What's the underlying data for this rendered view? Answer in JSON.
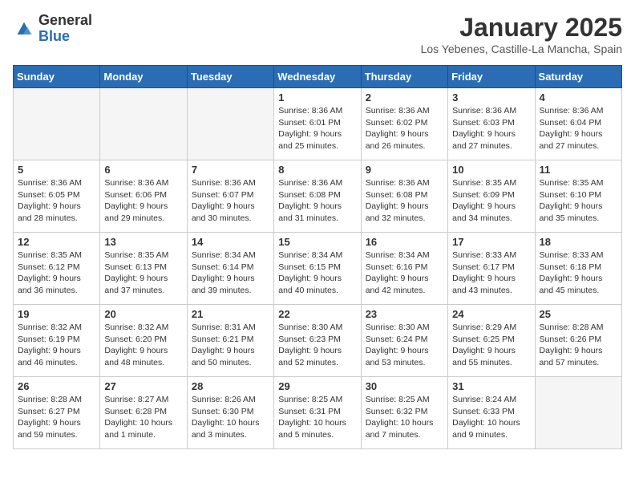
{
  "header": {
    "logo_general": "General",
    "logo_blue": "Blue",
    "month": "January 2025",
    "location": "Los Yebenes, Castille-La Mancha, Spain"
  },
  "days_of_week": [
    "Sunday",
    "Monday",
    "Tuesday",
    "Wednesday",
    "Thursday",
    "Friday",
    "Saturday"
  ],
  "weeks": [
    [
      {
        "day": "",
        "info": ""
      },
      {
        "day": "",
        "info": ""
      },
      {
        "day": "",
        "info": ""
      },
      {
        "day": "1",
        "info": "Sunrise: 8:36 AM\nSunset: 6:01 PM\nDaylight: 9 hours and 25 minutes."
      },
      {
        "day": "2",
        "info": "Sunrise: 8:36 AM\nSunset: 6:02 PM\nDaylight: 9 hours and 26 minutes."
      },
      {
        "day": "3",
        "info": "Sunrise: 8:36 AM\nSunset: 6:03 PM\nDaylight: 9 hours and 27 minutes."
      },
      {
        "day": "4",
        "info": "Sunrise: 8:36 AM\nSunset: 6:04 PM\nDaylight: 9 hours and 27 minutes."
      }
    ],
    [
      {
        "day": "5",
        "info": "Sunrise: 8:36 AM\nSunset: 6:05 PM\nDaylight: 9 hours and 28 minutes."
      },
      {
        "day": "6",
        "info": "Sunrise: 8:36 AM\nSunset: 6:06 PM\nDaylight: 9 hours and 29 minutes."
      },
      {
        "day": "7",
        "info": "Sunrise: 8:36 AM\nSunset: 6:07 PM\nDaylight: 9 hours and 30 minutes."
      },
      {
        "day": "8",
        "info": "Sunrise: 8:36 AM\nSunset: 6:08 PM\nDaylight: 9 hours and 31 minutes."
      },
      {
        "day": "9",
        "info": "Sunrise: 8:36 AM\nSunset: 6:08 PM\nDaylight: 9 hours and 32 minutes."
      },
      {
        "day": "10",
        "info": "Sunrise: 8:35 AM\nSunset: 6:09 PM\nDaylight: 9 hours and 34 minutes."
      },
      {
        "day": "11",
        "info": "Sunrise: 8:35 AM\nSunset: 6:10 PM\nDaylight: 9 hours and 35 minutes."
      }
    ],
    [
      {
        "day": "12",
        "info": "Sunrise: 8:35 AM\nSunset: 6:12 PM\nDaylight: 9 hours and 36 minutes."
      },
      {
        "day": "13",
        "info": "Sunrise: 8:35 AM\nSunset: 6:13 PM\nDaylight: 9 hours and 37 minutes."
      },
      {
        "day": "14",
        "info": "Sunrise: 8:34 AM\nSunset: 6:14 PM\nDaylight: 9 hours and 39 minutes."
      },
      {
        "day": "15",
        "info": "Sunrise: 8:34 AM\nSunset: 6:15 PM\nDaylight: 9 hours and 40 minutes."
      },
      {
        "day": "16",
        "info": "Sunrise: 8:34 AM\nSunset: 6:16 PM\nDaylight: 9 hours and 42 minutes."
      },
      {
        "day": "17",
        "info": "Sunrise: 8:33 AM\nSunset: 6:17 PM\nDaylight: 9 hours and 43 minutes."
      },
      {
        "day": "18",
        "info": "Sunrise: 8:33 AM\nSunset: 6:18 PM\nDaylight: 9 hours and 45 minutes."
      }
    ],
    [
      {
        "day": "19",
        "info": "Sunrise: 8:32 AM\nSunset: 6:19 PM\nDaylight: 9 hours and 46 minutes."
      },
      {
        "day": "20",
        "info": "Sunrise: 8:32 AM\nSunset: 6:20 PM\nDaylight: 9 hours and 48 minutes."
      },
      {
        "day": "21",
        "info": "Sunrise: 8:31 AM\nSunset: 6:21 PM\nDaylight: 9 hours and 50 minutes."
      },
      {
        "day": "22",
        "info": "Sunrise: 8:30 AM\nSunset: 6:23 PM\nDaylight: 9 hours and 52 minutes."
      },
      {
        "day": "23",
        "info": "Sunrise: 8:30 AM\nSunset: 6:24 PM\nDaylight: 9 hours and 53 minutes."
      },
      {
        "day": "24",
        "info": "Sunrise: 8:29 AM\nSunset: 6:25 PM\nDaylight: 9 hours and 55 minutes."
      },
      {
        "day": "25",
        "info": "Sunrise: 8:28 AM\nSunset: 6:26 PM\nDaylight: 9 hours and 57 minutes."
      }
    ],
    [
      {
        "day": "26",
        "info": "Sunrise: 8:28 AM\nSunset: 6:27 PM\nDaylight: 9 hours and 59 minutes."
      },
      {
        "day": "27",
        "info": "Sunrise: 8:27 AM\nSunset: 6:28 PM\nDaylight: 10 hours and 1 minute."
      },
      {
        "day": "28",
        "info": "Sunrise: 8:26 AM\nSunset: 6:30 PM\nDaylight: 10 hours and 3 minutes."
      },
      {
        "day": "29",
        "info": "Sunrise: 8:25 AM\nSunset: 6:31 PM\nDaylight: 10 hours and 5 minutes."
      },
      {
        "day": "30",
        "info": "Sunrise: 8:25 AM\nSunset: 6:32 PM\nDaylight: 10 hours and 7 minutes."
      },
      {
        "day": "31",
        "info": "Sunrise: 8:24 AM\nSunset: 6:33 PM\nDaylight: 10 hours and 9 minutes."
      },
      {
        "day": "",
        "info": ""
      }
    ]
  ]
}
